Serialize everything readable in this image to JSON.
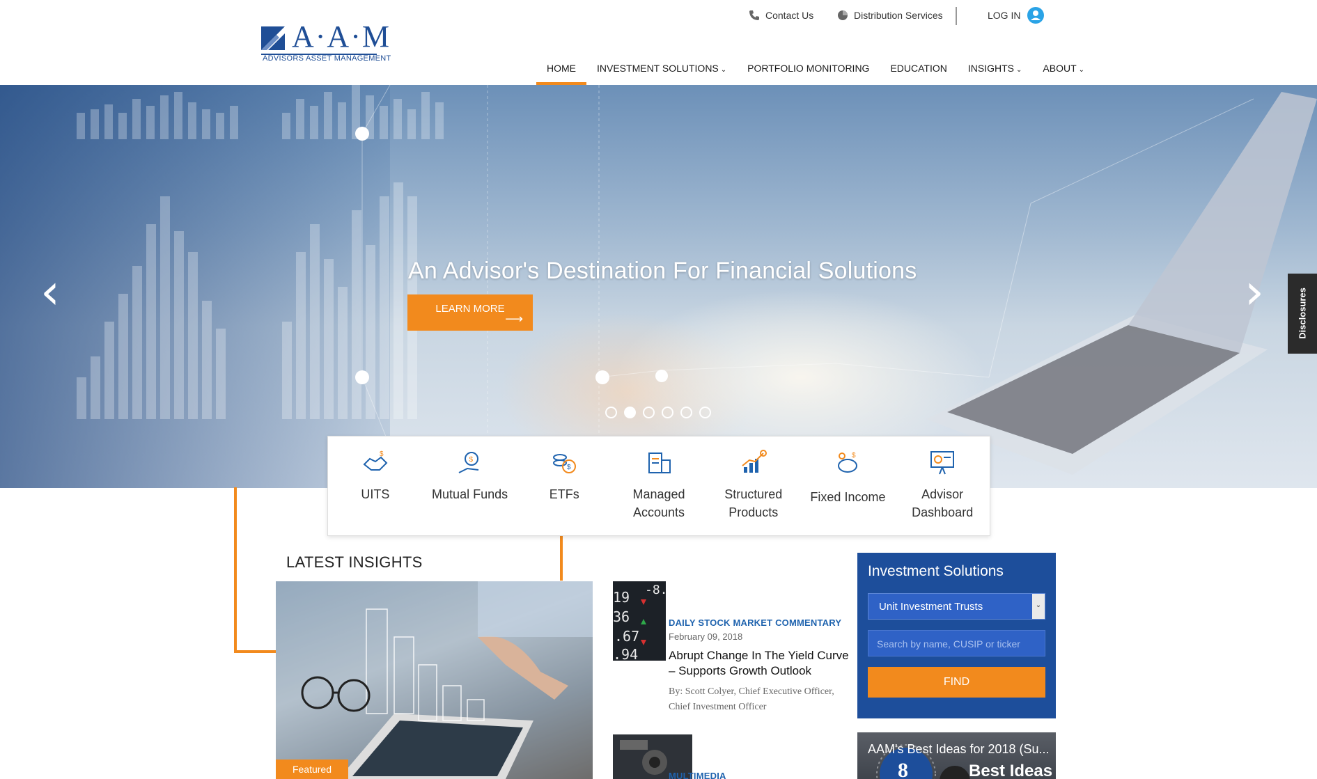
{
  "brand": {
    "logo_text": "A·A·M",
    "logo_sub": "ADVISORS ASSET MANAGEMENT"
  },
  "utility": {
    "contact": "Contact Us",
    "distribution": "Distribution Services",
    "login": "LOG IN"
  },
  "nav": {
    "items": [
      {
        "label": "HOME",
        "has_dropdown": false,
        "active": true
      },
      {
        "label": "INVESTMENT SOLUTIONS",
        "has_dropdown": true,
        "active": false
      },
      {
        "label": "PORTFOLIO MONITORING",
        "has_dropdown": false,
        "active": false
      },
      {
        "label": "EDUCATION",
        "has_dropdown": false,
        "active": false
      },
      {
        "label": "INSIGHTS",
        "has_dropdown": true,
        "active": false
      },
      {
        "label": "ABOUT",
        "has_dropdown": true,
        "active": false
      }
    ]
  },
  "hero": {
    "title": "An Advisor's Destination For Financial Solutions",
    "cta": "LEARN MORE",
    "slide_count": 6,
    "active_slide": 2,
    "disclosures": "Disclosures"
  },
  "categories": [
    {
      "label": "UITS",
      "icon": "handshake-icon"
    },
    {
      "label": "Mutual Funds",
      "icon": "money-bag-hand-icon"
    },
    {
      "label": "ETFs",
      "icon": "coins-icon"
    },
    {
      "label": "Managed Accounts",
      "icon": "ledger-calculator-icon"
    },
    {
      "label": "Structured Products",
      "icon": "growth-chart-icon"
    },
    {
      "label": "Fixed Income",
      "icon": "piggy-bank-icon"
    },
    {
      "label": "Advisor Dashboard",
      "icon": "presentation-board-icon"
    }
  ],
  "insights": {
    "heading": "LATEST INSIGHTS",
    "featured_badge": "Featured",
    "articles": [
      {
        "category": "DAILY STOCK MARKET COMMENTARY",
        "date": "February 09, 2018",
        "title": "Abrupt Change In The Yield Curve – Supports Growth Outlook",
        "byline": "By: Scott Colyer, Chief Executive Officer, Chief Investment Officer"
      },
      {
        "category": "MULTIMEDIA"
      }
    ]
  },
  "sidebar": {
    "title": "Investment Solutions",
    "select_value": "Unit Investment Trusts",
    "search_placeholder": "Search by name, CUSIP or ticker",
    "find": "FIND",
    "promo_title": "AAM's Best Ideas for 2018 (Su...",
    "promo_num": "8",
    "promo_big": "Best Ideas"
  },
  "colors": {
    "accent": "#f28a1d",
    "brand_blue": "#1f4e96",
    "panel_blue": "#1d4e9b"
  }
}
